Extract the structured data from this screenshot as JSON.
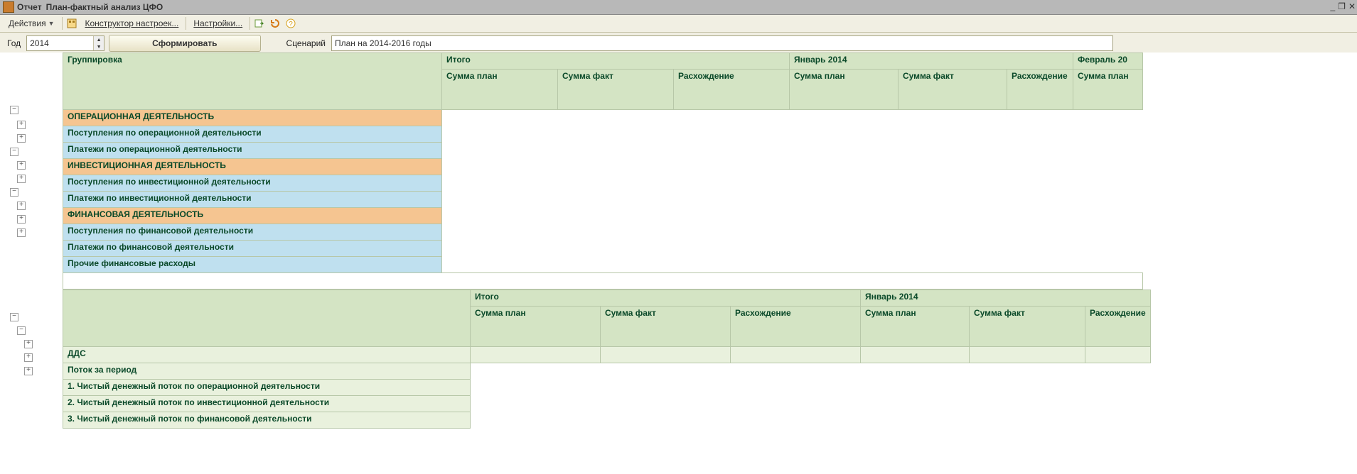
{
  "window": {
    "title_prefix": "Отчет",
    "title": "План-фактный анализ ЦФО"
  },
  "toolbar": {
    "actions": "Действия",
    "builder": "Конструктор настроек...",
    "settings": "Настройки...",
    "icon_builder": "builder-icon",
    "icon_export": "export-icon",
    "icon_refresh": "refresh-icon",
    "icon_help": "help-icon"
  },
  "filter": {
    "year_label": "Год",
    "year_value": "2014",
    "form_button": "Сформировать",
    "scenario_label": "Сценарий",
    "scenario_value": "План на 2014-2016 годы"
  },
  "headers": {
    "group": "Группировка",
    "total": "Итого",
    "sum_plan": "Сумма план",
    "sum_fact": "Сумма факт",
    "diff": "Расхождение",
    "jan": "Январь 2014",
    "feb": "Февраль 20",
    "diff_wrap": "Расхождение"
  },
  "sections": {
    "op": "ОПЕРАЦИОННАЯ ДЕЯТЕЛЬНОСТЬ",
    "op_in": "Поступления по операционной деятельности",
    "op_out": "Платежи по операционной деятельности",
    "inv": "ИНВЕСТИЦИОННАЯ ДЕЯТЕЛЬНОСТЬ",
    "inv_in": "Поступления по инвестиционной деятельности",
    "inv_out": "Платежи по инвестиционной деятельности",
    "fin": "ФИНАНСОВАЯ ДЕЯТЕЛЬНОСТЬ",
    "fin_in": "Поступления по финансовой деятельности",
    "fin_out": "Платежи по финансовой деятельности",
    "fin_other": "Прочие финансовые расходы"
  },
  "dds": {
    "title": "ДДС",
    "flow": "Поток за период",
    "r1": "1. Чистый денежный поток по операционной деятельности",
    "r2": "2. Чистый денежный поток по инвестиционной деятельности",
    "r3": "3. Чистый денежный поток по финансовой деятельности"
  },
  "headers2": {
    "total": "Итого",
    "sum_plan": "Сумма план",
    "sum_fact": "Сумма факт",
    "diff": "Расхождение",
    "jan": "Январь 2014",
    "diff_wrap": "Расхождение"
  }
}
